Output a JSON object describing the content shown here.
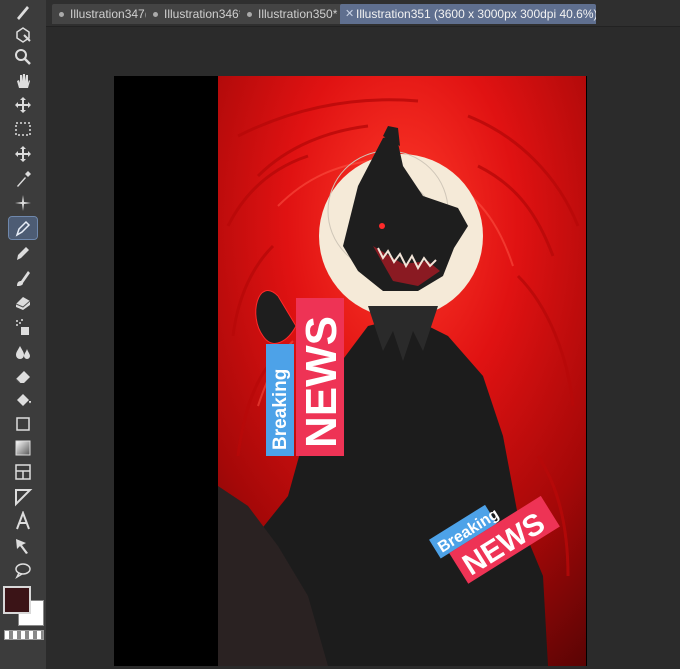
{
  "tabs": [
    {
      "label": "Illustration347(",
      "active": false
    },
    {
      "label": "Illustration346*",
      "active": false
    },
    {
      "label": "Illustration350*",
      "active": false
    },
    {
      "label": "Illustration351 (3600 x 3000px 300dpi 40.6%)",
      "active": true
    }
  ],
  "tools": [
    "pen-icon",
    "operation-icon",
    "zoom-icon",
    "hand-icon",
    "move-icon",
    "selection-icon",
    "move-layer-icon",
    "eyedropper-icon",
    "auto-select-icon",
    "vector-pen-icon",
    "pencil-icon",
    "brush-icon",
    "blend-icon",
    "airbrush-icon",
    "fill-icon",
    "eraser-icon",
    "bucket-icon",
    "rectangle-icon",
    "gradient-icon",
    "frame-icon",
    "ruler-icon",
    "text-icon",
    "correct-line-icon",
    "balloon-icon"
  ],
  "artwork": {
    "sign1": {
      "small": "Breaking",
      "big": "NEWS"
    },
    "sign2": {
      "small": "Breaking",
      "big": "NEWS"
    }
  },
  "colors": {
    "main": "#3b1417",
    "sub": "#ffffff",
    "accent": "#5f6f8f",
    "red": "#d90a0a"
  }
}
